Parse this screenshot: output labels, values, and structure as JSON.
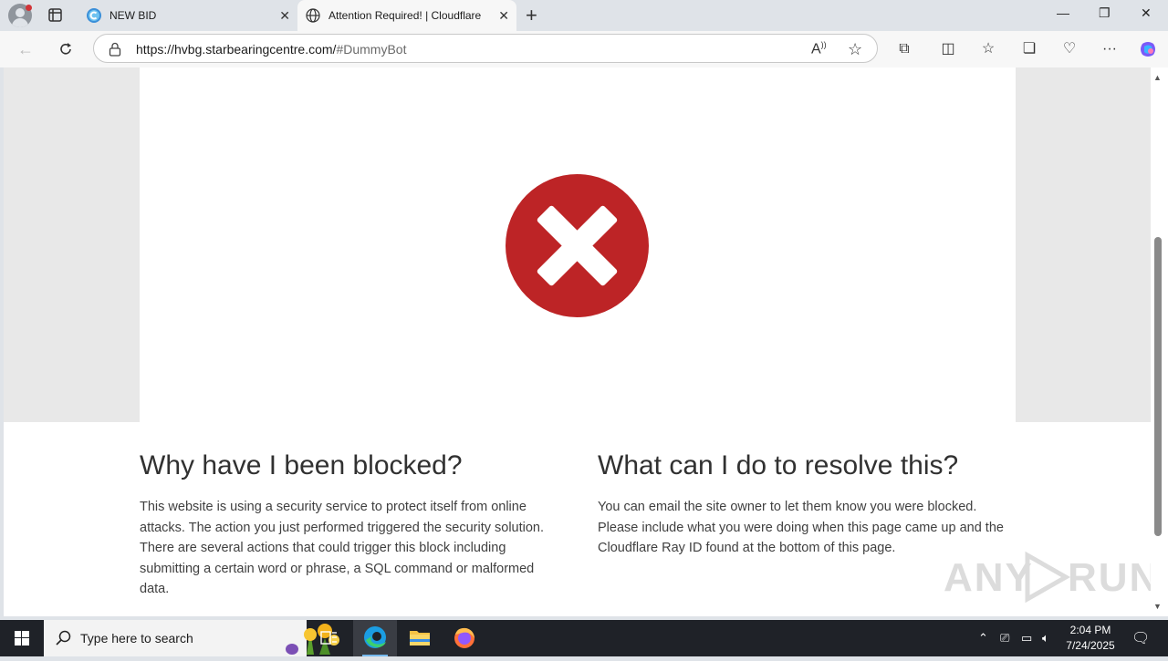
{
  "browser": {
    "tabs": [
      {
        "title": "NEW BID",
        "favicon": "c-logo-icon",
        "active": false
      },
      {
        "title": "Attention Required! | Cloudflare",
        "favicon": "globe-icon",
        "active": true
      }
    ],
    "address": {
      "host": "https://hvbg.starbearingcentre.com/",
      "fragment": "#DummyBot"
    }
  },
  "page": {
    "left_heading": "Why have I been blocked?",
    "left_text": "This website is using a security service to protect itself from online attacks. The action you just performed triggered the security solution. There are several actions that could trigger this block including submitting a certain word or phrase, a SQL command or malformed data.",
    "right_heading": "What can I do to resolve this?",
    "right_text": "You can email the site owner to let them know you were blocked. Please include what you were doing when this page came up and the Cloudflare Ray ID found at the bottom of this page.",
    "watermark": "ANY RUN",
    "error_color": "#bd2426"
  },
  "taskbar": {
    "search_placeholder": "Type here to search",
    "time": "2:04 PM",
    "date": "7/24/2025"
  }
}
